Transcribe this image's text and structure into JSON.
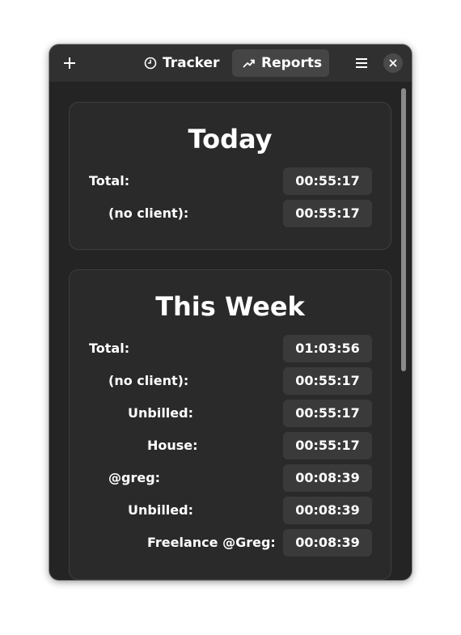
{
  "headerbar": {
    "tabs": [
      {
        "label": "Tracker",
        "icon": "clock-icon",
        "active": false
      },
      {
        "label": "Reports",
        "icon": "chart-trend-icon",
        "active": true
      }
    ],
    "add_icon": "plus-icon",
    "menu_icon": "hamburger-menu-icon",
    "close_icon": "close-icon"
  },
  "today": {
    "title": "Today",
    "rows": [
      {
        "label": "Total:",
        "value": "00:55:17"
      },
      {
        "label": "(no client):",
        "value": "00:55:17"
      }
    ]
  },
  "week": {
    "title": "This Week",
    "rows": [
      {
        "label": "Total:",
        "value": "01:03:56"
      },
      {
        "label": "(no client):",
        "value": "00:55:17"
      },
      {
        "label": "Unbilled:",
        "value": "00:55:17"
      },
      {
        "label": "House:",
        "value": "00:55:17"
      },
      {
        "label": "@greg:",
        "value": "00:08:39"
      },
      {
        "label": "Unbilled:",
        "value": "00:08:39"
      },
      {
        "label": "Freelance @Greg:",
        "value": "00:08:39"
      }
    ]
  },
  "colors": {
    "window_bg": "#242424",
    "headerbar_bg": "#303030",
    "card_bg": "#2a2a2a",
    "value_bg": "#3a3a3a",
    "active_tab_bg": "#454545",
    "text": "#ffffff"
  }
}
